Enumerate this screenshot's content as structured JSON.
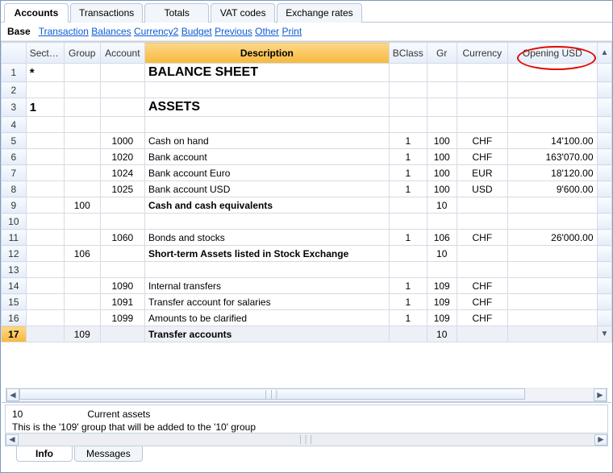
{
  "topTabs": [
    {
      "label": "Accounts",
      "active": true
    },
    {
      "label": "Transactions",
      "active": false
    },
    {
      "label": "Totals",
      "active": false
    },
    {
      "label": "VAT codes",
      "active": false
    },
    {
      "label": "Exchange rates",
      "active": false
    }
  ],
  "subMenu": {
    "base": "Base",
    "items": [
      "Transaction",
      "Balances",
      "Currency2",
      "Budget",
      "Previous",
      "Other",
      "Print"
    ]
  },
  "headers": {
    "section": "Section",
    "group": "Group",
    "account": "Account",
    "description": "Description",
    "bclass": "BClass",
    "gr": "Gr",
    "currency": "Currency",
    "opening": "Opening USD"
  },
  "rows": [
    {
      "n": "1",
      "section": "*",
      "group": "",
      "account": "",
      "desc": "BALANCE SHEET",
      "bclass": "",
      "gr": "",
      "currency": "",
      "opening": "",
      "style": "heading"
    },
    {
      "n": "2",
      "section": "",
      "group": "",
      "account": "",
      "desc": "",
      "bclass": "",
      "gr": "",
      "currency": "",
      "opening": "",
      "style": ""
    },
    {
      "n": "3",
      "section": "1",
      "group": "",
      "account": "",
      "desc": "ASSETS",
      "bclass": "",
      "gr": "",
      "currency": "",
      "opening": "",
      "style": "heading"
    },
    {
      "n": "4",
      "section": "",
      "group": "",
      "account": "",
      "desc": "",
      "bclass": "",
      "gr": "",
      "currency": "",
      "opening": "",
      "style": ""
    },
    {
      "n": "5",
      "section": "",
      "group": "",
      "account": "1000",
      "desc": "Cash on hand",
      "bclass": "1",
      "gr": "100",
      "currency": "CHF",
      "opening": "14'100.00",
      "style": ""
    },
    {
      "n": "6",
      "section": "",
      "group": "",
      "account": "1020",
      "desc": "Bank account",
      "bclass": "1",
      "gr": "100",
      "currency": "CHF",
      "opening": "163'070.00",
      "style": ""
    },
    {
      "n": "7",
      "section": "",
      "group": "",
      "account": "1024",
      "desc": "Bank account Euro",
      "bclass": "1",
      "gr": "100",
      "currency": "EUR",
      "opening": "18'120.00",
      "style": ""
    },
    {
      "n": "8",
      "section": "",
      "group": "",
      "account": "1025",
      "desc": "Bank account USD",
      "bclass": "1",
      "gr": "100",
      "currency": "USD",
      "opening": "9'600.00",
      "style": ""
    },
    {
      "n": "9",
      "section": "",
      "group": "100",
      "account": "",
      "desc": "Cash and cash equivalents",
      "bclass": "",
      "gr": "10",
      "currency": "",
      "opening": "",
      "style": "bold"
    },
    {
      "n": "10",
      "section": "",
      "group": "",
      "account": "",
      "desc": "",
      "bclass": "",
      "gr": "",
      "currency": "",
      "opening": "",
      "style": ""
    },
    {
      "n": "11",
      "section": "",
      "group": "",
      "account": "1060",
      "desc": "Bonds and stocks",
      "bclass": "1",
      "gr": "106",
      "currency": "CHF",
      "opening": "26'000.00",
      "style": ""
    },
    {
      "n": "12",
      "section": "",
      "group": "106",
      "account": "",
      "desc": "Short-term Assets listed in Stock Exchange",
      "bclass": "",
      "gr": "10",
      "currency": "",
      "opening": "",
      "style": "bold"
    },
    {
      "n": "13",
      "section": "",
      "group": "",
      "account": "",
      "desc": "",
      "bclass": "",
      "gr": "",
      "currency": "",
      "opening": "",
      "style": ""
    },
    {
      "n": "14",
      "section": "",
      "group": "",
      "account": "1090",
      "desc": "Internal transfers",
      "bclass": "1",
      "gr": "109",
      "currency": "CHF",
      "opening": "",
      "style": ""
    },
    {
      "n": "15",
      "section": "",
      "group": "",
      "account": "1091",
      "desc": "Transfer account for salaries",
      "bclass": "1",
      "gr": "109",
      "currency": "CHF",
      "opening": "",
      "style": ""
    },
    {
      "n": "16",
      "section": "",
      "group": "",
      "account": "1099",
      "desc": "Amounts to be clarified",
      "bclass": "1",
      "gr": "109",
      "currency": "CHF",
      "opening": "",
      "style": ""
    },
    {
      "n": "17",
      "section": "",
      "group": "109",
      "account": "",
      "desc": "Transfer accounts",
      "bclass": "",
      "gr": "10",
      "currency": "",
      "opening": "",
      "style": "bold selected"
    }
  ],
  "infoPanel": {
    "line1a": "10",
    "line1b": "Current assets",
    "line2": "This is the '109' group that will be added to the '10' group"
  },
  "bottomTabs": [
    {
      "label": "Info",
      "active": true
    },
    {
      "label": "Messages",
      "active": false
    }
  ]
}
